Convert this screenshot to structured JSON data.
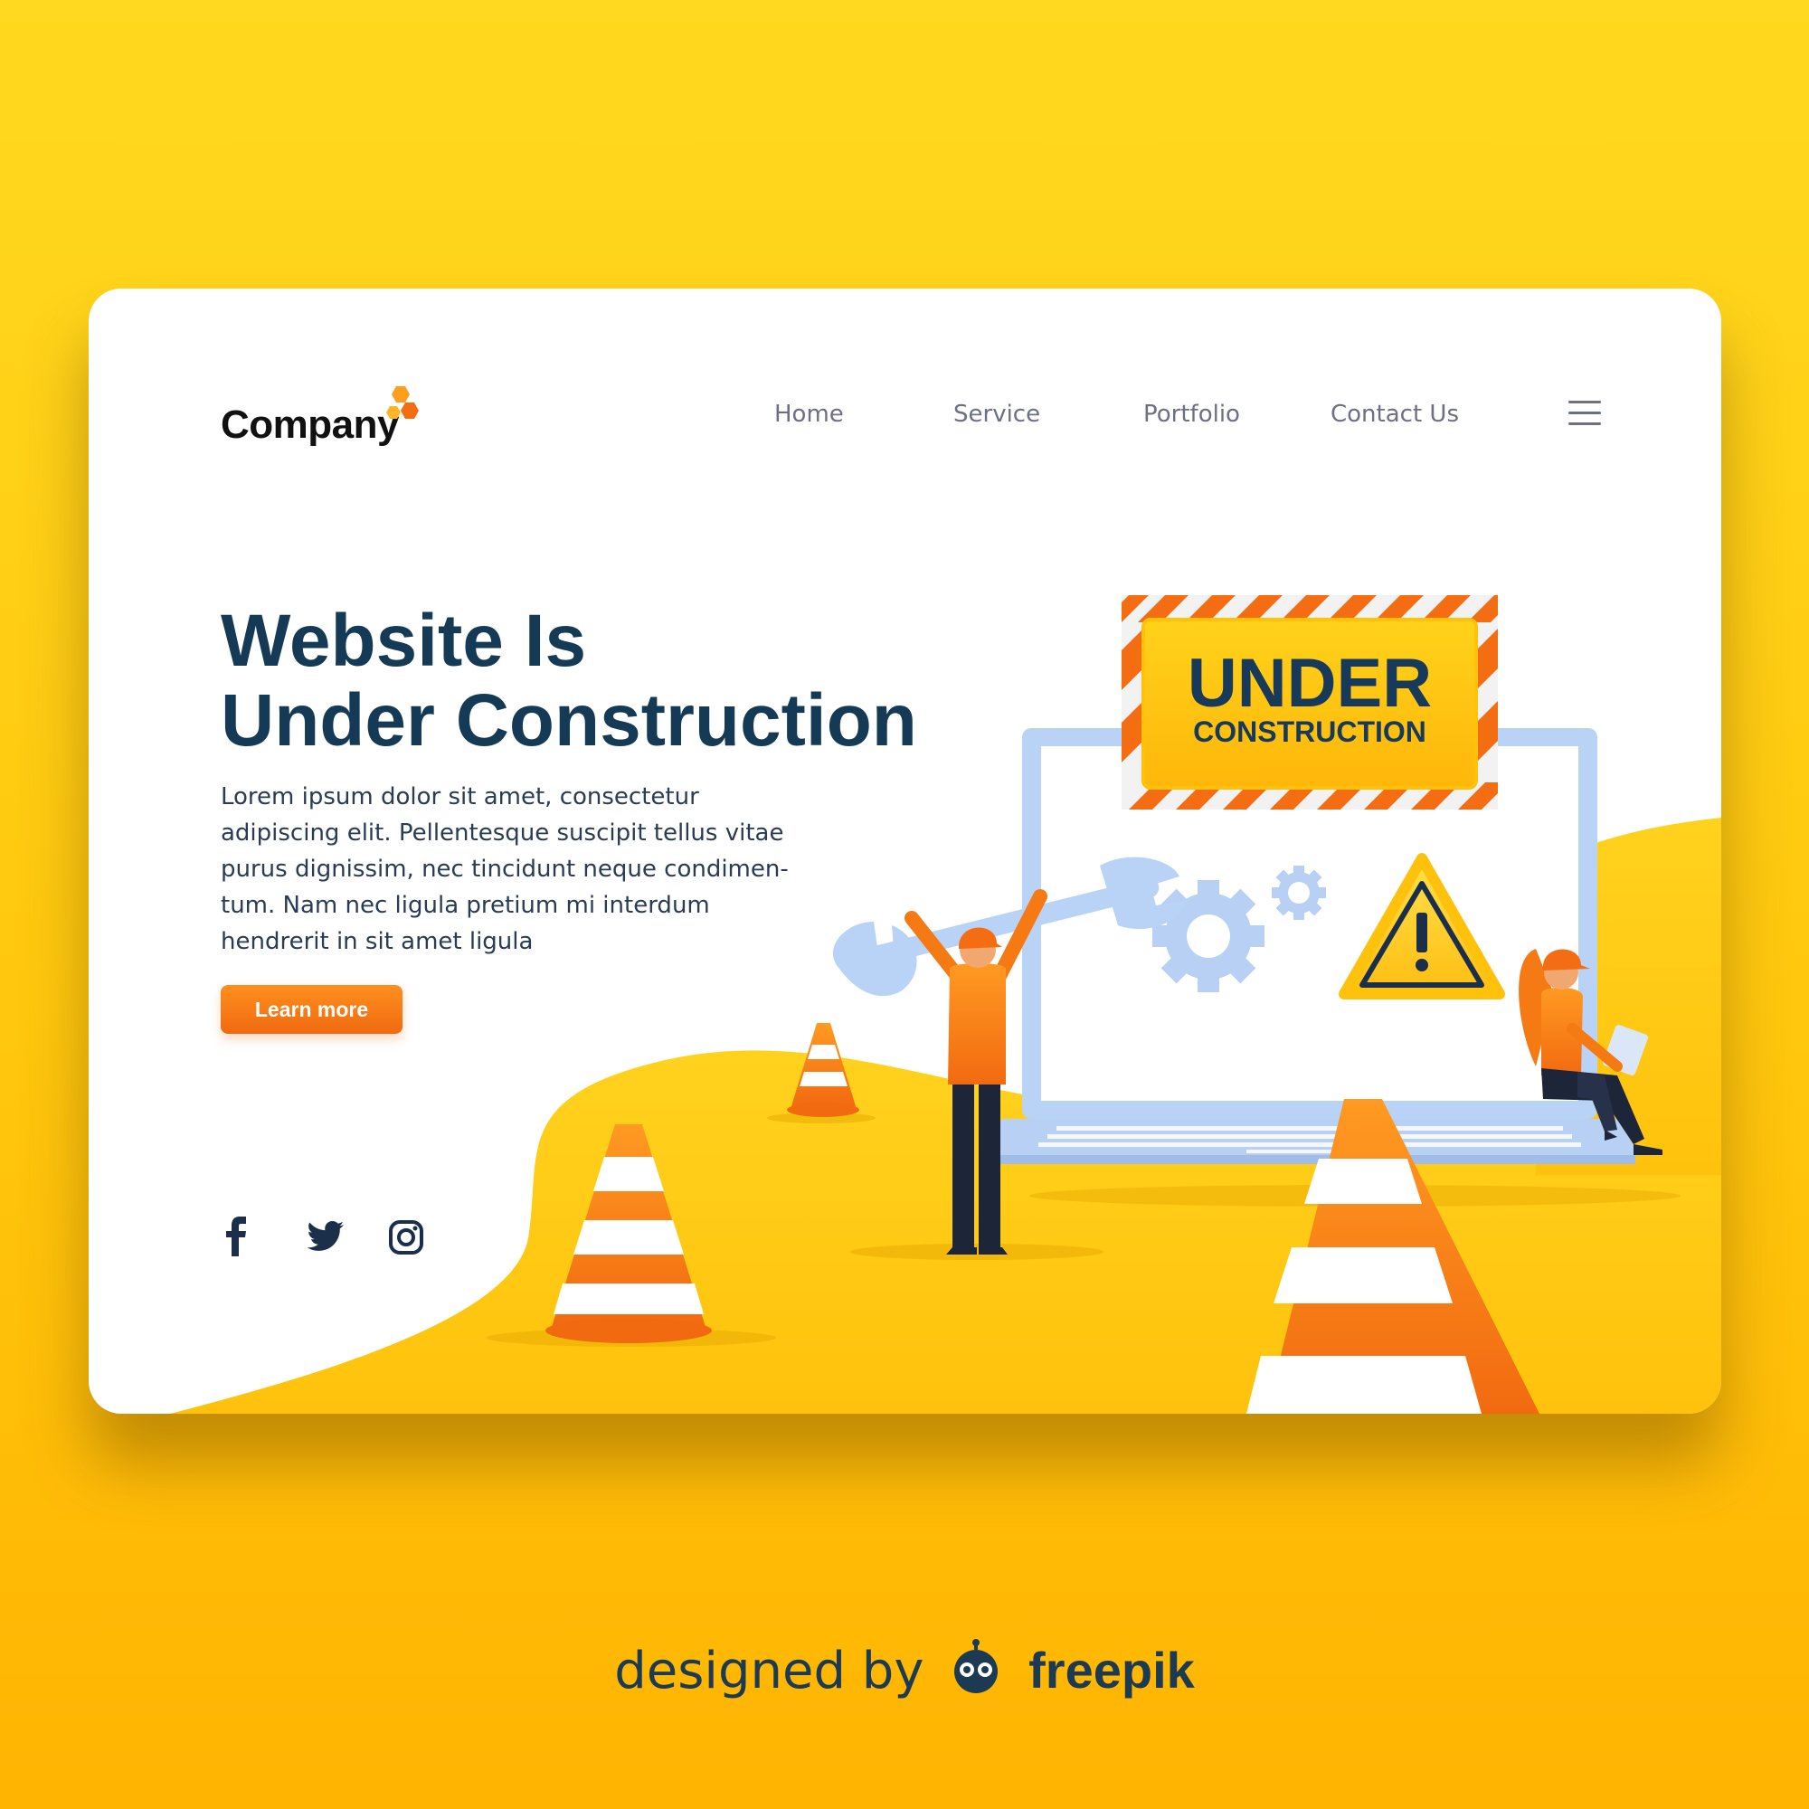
{
  "brand": {
    "name": "Company"
  },
  "nav": {
    "items": [
      {
        "label": "Home"
      },
      {
        "label": "Service"
      },
      {
        "label": "Portfolio"
      },
      {
        "label": "Contact Us"
      }
    ]
  },
  "hero": {
    "title_line1": "Website Is",
    "title_line2": "Under Construction",
    "body": "Lorem ipsum dolor sit amet, consectetur adipiscing elit. Pellentesque suscipit tellus vitae purus dignissim, nec tincidunt neque condimen-tum. Nam nec ligula pretium mi interdum hendrerit in sit amet ligula",
    "cta_label": "Learn more"
  },
  "illustration": {
    "sign_line1": "UNDER",
    "sign_line2": "CONSTRUCTION"
  },
  "footer": {
    "prefix": "designed by",
    "brand": "freepik"
  },
  "colors": {
    "background": "#FFD11A",
    "accent_orange": "#F56D12",
    "title_navy": "#153A55",
    "nav_gray": "#6D6F84",
    "laptop_blue": "#B9D3F7"
  }
}
